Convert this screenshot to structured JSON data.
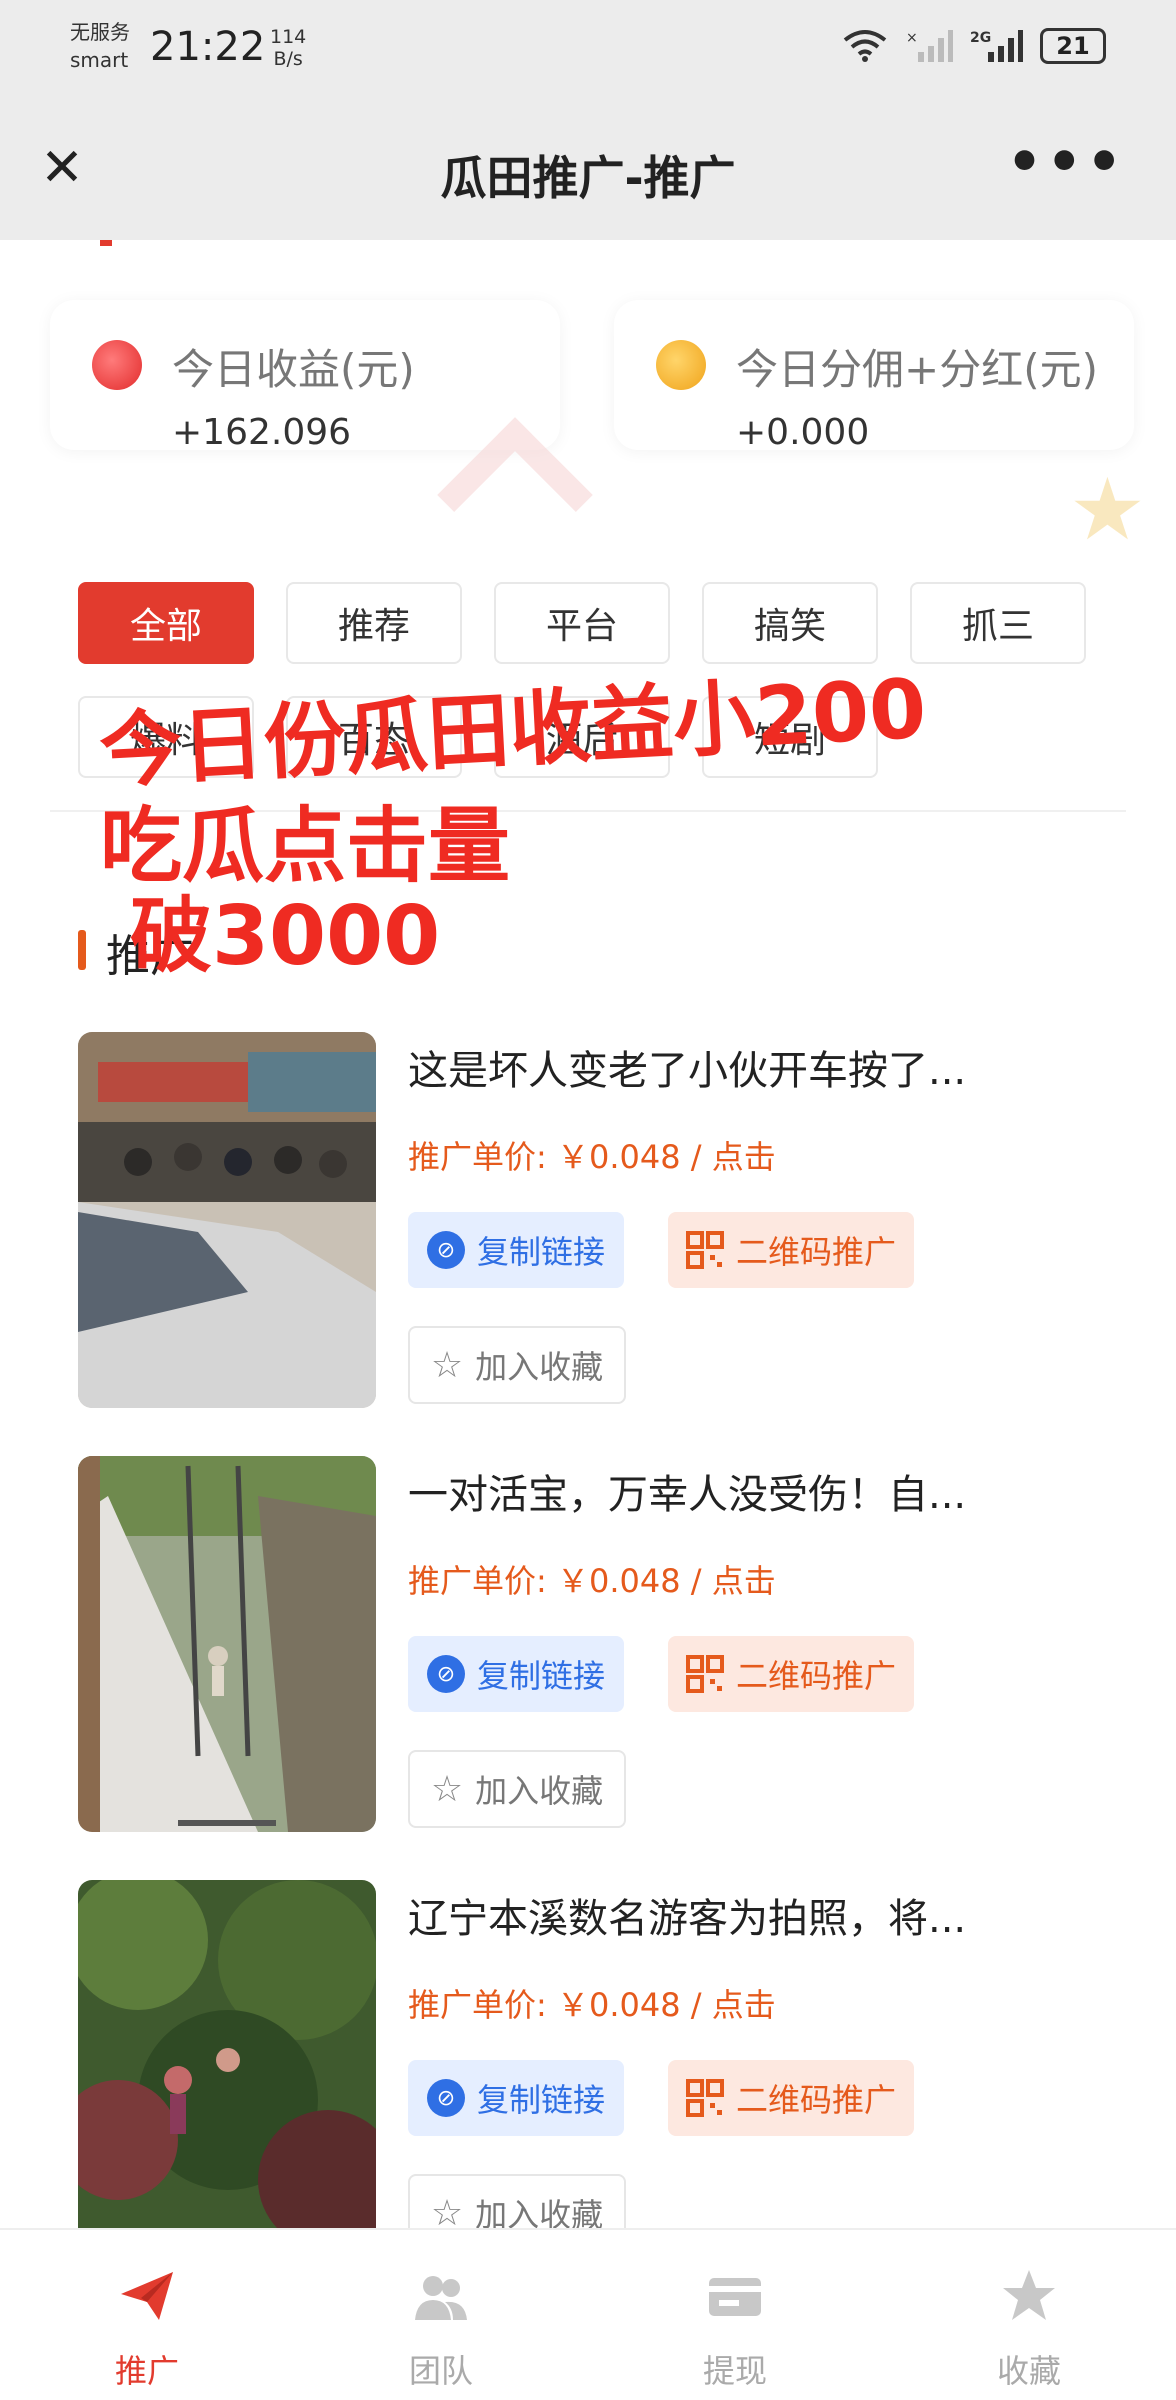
{
  "status_bar": {
    "service": "无服务",
    "carrier": "smart",
    "time": "21:22",
    "speed_value": "114",
    "speed_unit": "B/s",
    "battery": "21"
  },
  "nav": {
    "title": "瓜田推广-推广"
  },
  "stats": {
    "today_income_label": "今日收益(元)",
    "today_income_value": "+162.096",
    "today_commission_label": "今日分佣+分红(元)",
    "today_commission_value": "+0.000"
  },
  "categories": [
    "全部",
    "推荐",
    "平台",
    "搞笑",
    "抓三",
    "爆料",
    "百态",
    "酒后",
    "短剧"
  ],
  "overlay": {
    "line1": "今日份瓜田收益小200",
    "line2": "吃瓜点击量",
    "line3": "破3000"
  },
  "section": {
    "title": "推广"
  },
  "items": [
    {
      "title": "这是坏人变老了小伙开车按了...",
      "price": "推广单价: ￥0.048 / 点击",
      "copy_label": "复制链接",
      "qr_label": "二维码推广",
      "fav_label": "加入收藏"
    },
    {
      "title": "一对活宝，万幸人没受伤！自...",
      "price": "推广单价: ￥0.048 / 点击",
      "copy_label": "复制链接",
      "qr_label": "二维码推广",
      "fav_label": "加入收藏"
    },
    {
      "title": "辽宁本溪数名游客为拍照，将...",
      "price": "推广单价: ￥0.048 / 点击",
      "copy_label": "复制链接",
      "qr_label": "二维码推广",
      "fav_label": "加入收藏"
    }
  ],
  "tabs": [
    {
      "label": "推广",
      "icon": "paper-plane-icon",
      "active": true
    },
    {
      "label": "团队",
      "icon": "team-icon",
      "active": false
    },
    {
      "label": "提现",
      "icon": "wallet-icon",
      "active": false
    },
    {
      "label": "收藏",
      "icon": "star-icon",
      "active": false
    }
  ],
  "colors": {
    "accent_red": "#e23b2e",
    "price_orange": "#e55a1c",
    "copy_blue": "#2f6fe4"
  }
}
